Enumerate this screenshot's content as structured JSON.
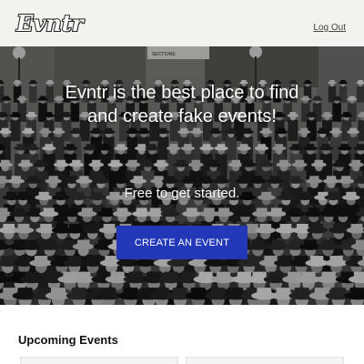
{
  "navbar": {
    "logo_text": "Evntr",
    "logout_label": "Log Out"
  },
  "hero": {
    "headline": "Evntr is the best place to find and create fake events!",
    "subheadline": "Free to get started.",
    "cta_label": "CREATE AN EVENT",
    "sign_text": "SECTIONS",
    "accent_color": "#2238b8"
  },
  "upcoming": {
    "title": "Upcoming Events",
    "cards": [
      {},
      {}
    ]
  }
}
